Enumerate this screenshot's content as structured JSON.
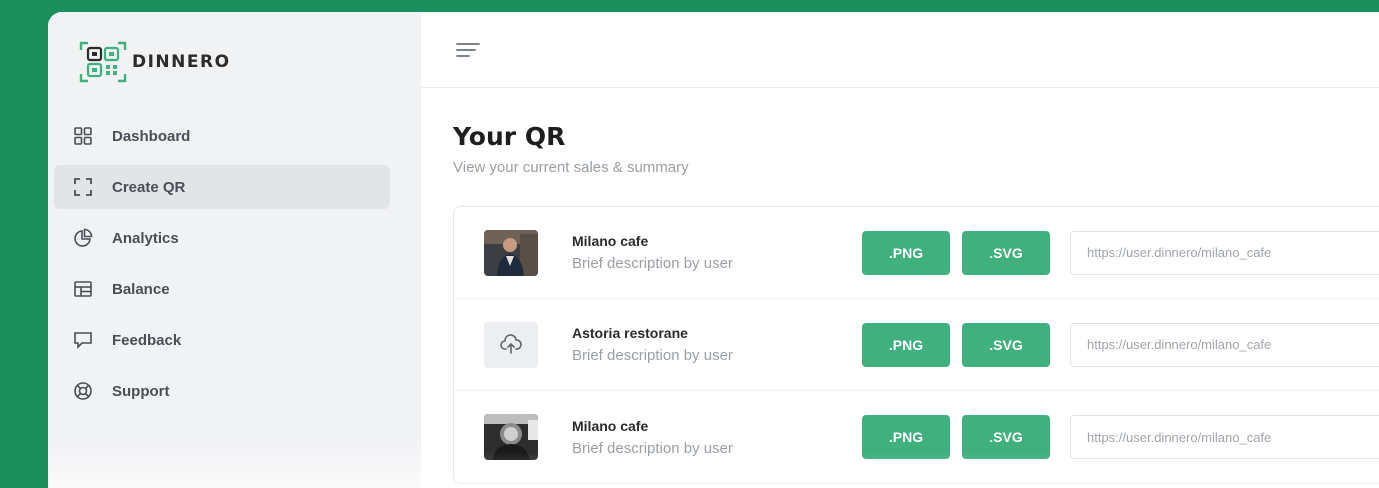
{
  "brand": {
    "name": "DINNERO",
    "accent": "#41b07f",
    "background": "#1a8f5c"
  },
  "sidebar": {
    "items": [
      {
        "label": "Dashboard",
        "icon": "grid-icon",
        "active": false
      },
      {
        "label": "Create QR",
        "icon": "scan-frame-icon",
        "active": true
      },
      {
        "label": "Analytics",
        "icon": "pie-chart-icon",
        "active": false
      },
      {
        "label": "Balance",
        "icon": "balance-icon",
        "active": false
      },
      {
        "label": "Feedback",
        "icon": "chat-icon",
        "active": false
      },
      {
        "label": "Support",
        "icon": "lifebuoy-icon",
        "active": false
      }
    ]
  },
  "header": {
    "menu_icon": "hamburger-icon"
  },
  "main": {
    "title": "Your QR",
    "subtitle": "View your current sales & summary",
    "rows": [
      {
        "name": "Milano cafe",
        "description": "Brief description by user",
        "png_label": ".PNG",
        "svg_label": ".SVG",
        "url": "https://user.dinnero/milano_cafe",
        "thumb": "photo-thumbnail"
      },
      {
        "name": "Astoria restorane",
        "description": "Brief description by user",
        "png_label": ".PNG",
        "svg_label": ".SVG",
        "url": "https://user.dinnero/milano_cafe",
        "thumb": "upload-icon"
      },
      {
        "name": "Milano cafe",
        "description": "Brief description by user",
        "png_label": ".PNG",
        "svg_label": ".SVG",
        "url": "https://user.dinnero/milano_cafe",
        "thumb": "photo-thumbnail"
      }
    ]
  }
}
